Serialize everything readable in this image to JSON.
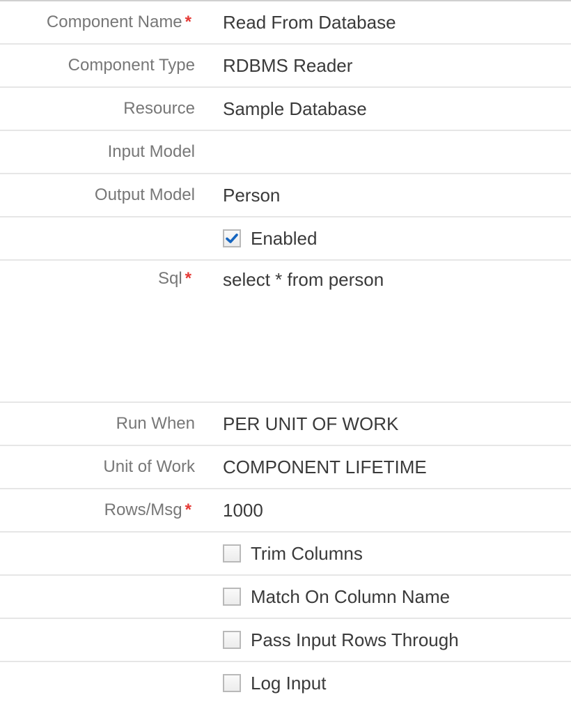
{
  "fields": [
    {
      "label": "Component Name",
      "required": true,
      "value": "Read From Database"
    },
    {
      "label": "Component Type",
      "required": false,
      "value": "RDBMS Reader"
    },
    {
      "label": "Resource",
      "required": false,
      "value": "Sample Database"
    },
    {
      "label": "Input Model",
      "required": false,
      "value": ""
    },
    {
      "label": "Output Model",
      "required": false,
      "value": "Person"
    }
  ],
  "enabled": {
    "label": "Enabled",
    "checked": true
  },
  "sql": {
    "label": "Sql",
    "required": true,
    "value": "select * from person"
  },
  "fields2": [
    {
      "label": "Run When",
      "required": false,
      "value": "PER UNIT OF WORK"
    },
    {
      "label": "Unit of Work",
      "required": false,
      "value": "COMPONENT LIFETIME"
    },
    {
      "label": "Rows/Msg",
      "required": true,
      "value": "1000"
    }
  ],
  "checkboxes": [
    {
      "label": "Trim Columns",
      "checked": false
    },
    {
      "label": "Match On Column Name",
      "checked": false
    },
    {
      "label": "Pass Input Rows Through",
      "checked": false
    },
    {
      "label": "Log Input",
      "checked": false
    }
  ],
  "required_marker": "*",
  "colors": {
    "required": "#e53935",
    "check": "#1565c0"
  }
}
